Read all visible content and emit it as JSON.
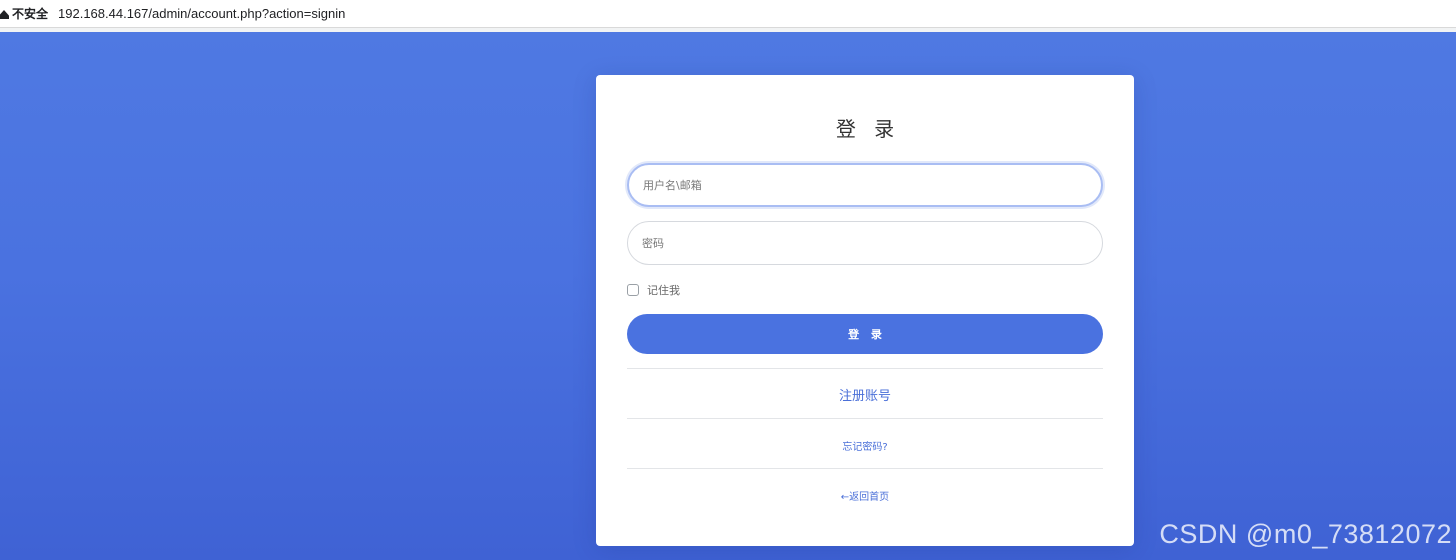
{
  "address_bar": {
    "security_label": "不安全",
    "url": "192.168.44.167/admin/account.php?action=signin",
    "warning_icon": "warning-triangle-icon"
  },
  "login_card": {
    "title": "登 录",
    "username_placeholder": "用户名\\邮箱",
    "password_placeholder": "密码",
    "remember_label": "记住我",
    "login_button_label": "登 录",
    "register_link": "注册账号",
    "forgot_link": "忘记密码?",
    "home_link": "←返回首页"
  },
  "watermark": "CSDN @m0_73812072",
  "colors": {
    "background": "#4a72e0",
    "accent": "#4a72e0",
    "link": "#4a6fd8",
    "card": "#ffffff"
  }
}
